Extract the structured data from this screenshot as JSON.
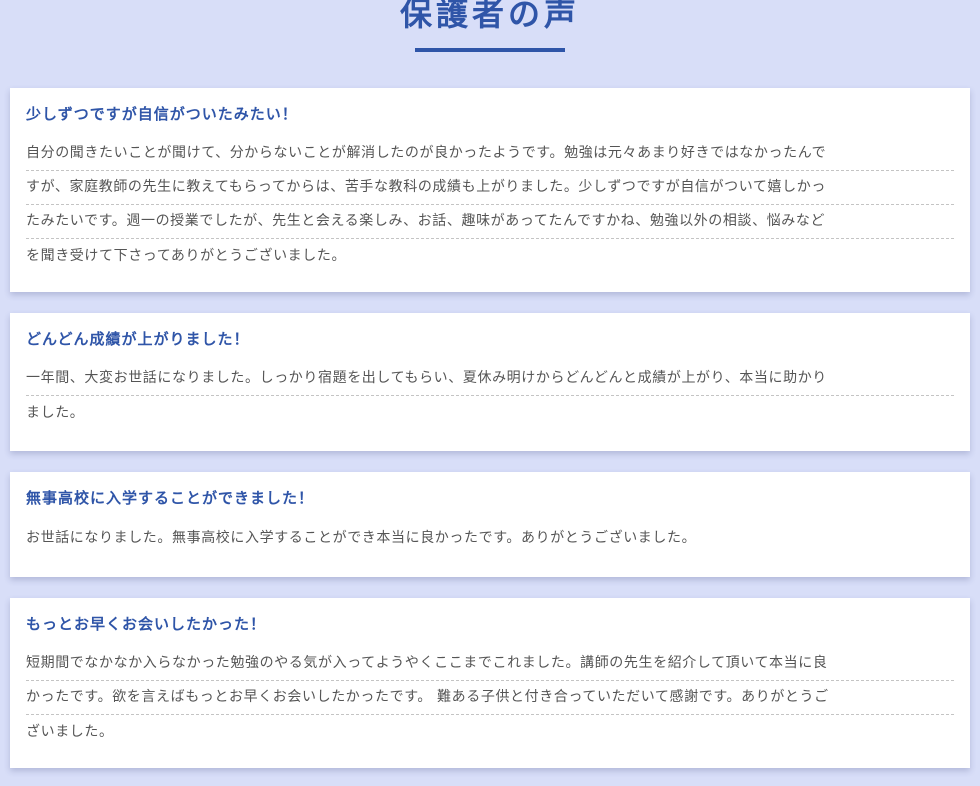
{
  "section": {
    "title": "保護者の声"
  },
  "testimonials": [
    {
      "title": "少しずつですが自信がついたみたい！",
      "lines": [
        "自分の聞きたいことが聞けて、分からないことが解消したのが良かったようです。勉強は元々あまり好きではなかったんで",
        "すが、家庭教師の先生に教えてもらってからは、苦手な教科の成績も上がりました。少しずつですが自信がついて嬉しかっ",
        "たみたいです。週一の授業でしたが、先生と会える楽しみ、お話、趣味があってたんですかね、勉強以外の相談、悩みなど",
        "を聞き受けて下さってありがとうございました。"
      ]
    },
    {
      "title": "どんどん成績が上がりました！",
      "lines": [
        "一年間、大変お世話になりました。しっかり宿題を出してもらい、夏休み明けからどんどんと成績が上がり、本当に助かり",
        "ました。"
      ]
    },
    {
      "title": "無事高校に入学することができました！",
      "lines": [
        "お世話になりました。無事高校に入学することができ本当に良かったです。ありがとうございました。"
      ]
    },
    {
      "title": "もっとお早くお会いしたかった！",
      "lines": [
        "短期間でなかなか入らなかった勉強のやる気が入ってようやくここまでこれました。講師の先生を紹介して頂いて本当に良",
        "かったです。欲を言えばもっとお早くお会いしたかったです。 難ある子供と付き合っていただいて感謝です。ありがとうご",
        "ざいました。"
      ]
    }
  ]
}
